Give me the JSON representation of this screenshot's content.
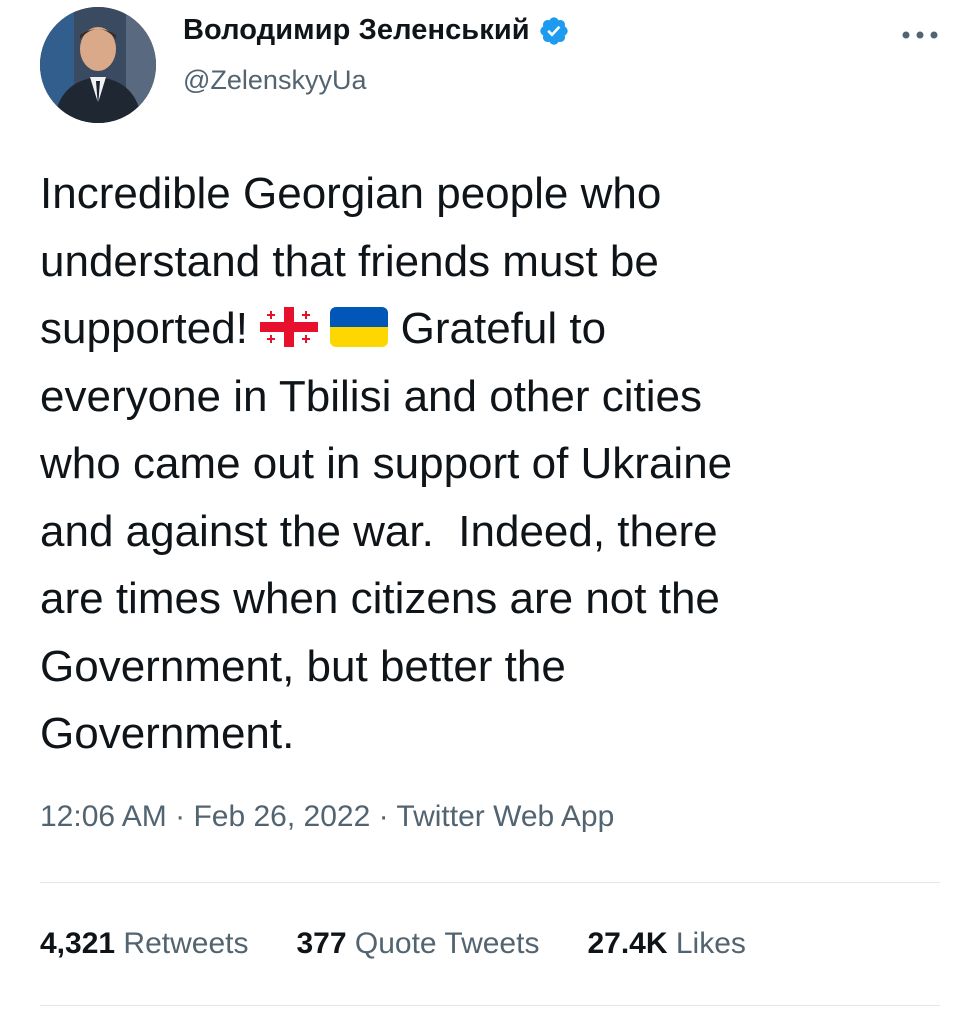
{
  "author": {
    "display_name": "Володимир Зеленський",
    "handle": "@ZelenskyyUa",
    "verified": true
  },
  "icons": {
    "verified": "verified-badge-icon",
    "more": "more-options-icon",
    "flag_1": "georgia-flag",
    "flag_2": "ukraine-flag"
  },
  "tweet": {
    "lines": [
      "Incredible Georgian people who",
      "understand that friends must be",
      "supported! ",
      " Grateful to",
      "everyone in Tbilisi and other cities",
      "who came out in support of Ukraine",
      "and against the war.  Indeed, there",
      "are times when citizens are not the",
      "Government, but better the",
      "Government."
    ]
  },
  "meta": {
    "time": "12:06 AM",
    "date": "Feb 26, 2022",
    "source": "Twitter Web App",
    "separator": "·"
  },
  "stats": {
    "retweets": {
      "count": "4,321",
      "label": "Retweets"
    },
    "quote_tweets": {
      "count": "377",
      "label": "Quote Tweets"
    },
    "likes": {
      "count": "27.4K",
      "label": "Likes"
    }
  },
  "colors": {
    "text_primary": "#0f1419",
    "text_secondary": "#536471",
    "verified_blue": "#1d9bf0",
    "divider": "#e4e8eb",
    "ukraine_blue": "#0057b7",
    "ukraine_yellow": "#ffd700",
    "georgia_red": "#e8112d"
  }
}
